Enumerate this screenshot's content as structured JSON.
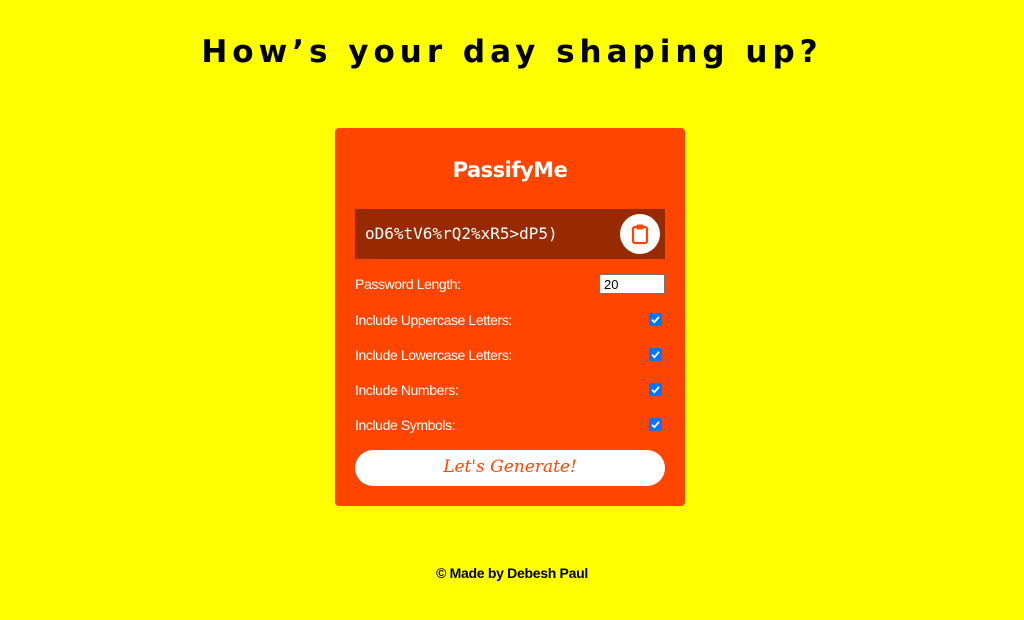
{
  "page": {
    "heading": "How’s your day shaping up?",
    "footer": "© Made by Debesh Paul"
  },
  "card": {
    "brand": "PassifyMe",
    "password": "oD6%tV6%rQ2%xR5>dP5)",
    "copy_icon": "clipboard-icon",
    "length_label": "Password Length:",
    "length_value": "20",
    "options": [
      {
        "label": "Include Uppercase Letters:",
        "checked": true
      },
      {
        "label": "Include Lowercase Letters:",
        "checked": true
      },
      {
        "label": "Include Numbers:",
        "checked": true
      },
      {
        "label": "Include Symbols:",
        "checked": true
      }
    ],
    "generate_label": "Let's Generate!"
  },
  "colors": {
    "background": "#ffff00",
    "card": "#ff4500",
    "result_box": "#972a00",
    "checkbox": "#0075ff"
  }
}
